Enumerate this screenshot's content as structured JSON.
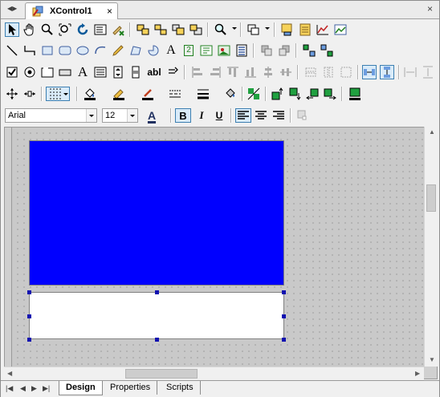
{
  "tabs": {
    "document_title": "XControl1",
    "close_glyph": "×"
  },
  "toolbar": {
    "font_name": "Arial",
    "font_size": "12",
    "bold_label": "B",
    "italic_label": "I",
    "underline_label": "U",
    "font_color_label": "A",
    "text_tool_label": "A",
    "textbox_label": "abl",
    "number_label": "2"
  },
  "bottom_tabs": [
    {
      "label": "Design",
      "active": true
    },
    {
      "label": "Properties",
      "active": false
    },
    {
      "label": "Scripts",
      "active": false
    }
  ],
  "colors": {
    "fill_blue": "#0000ff",
    "selection_handle": "#1010b0"
  }
}
